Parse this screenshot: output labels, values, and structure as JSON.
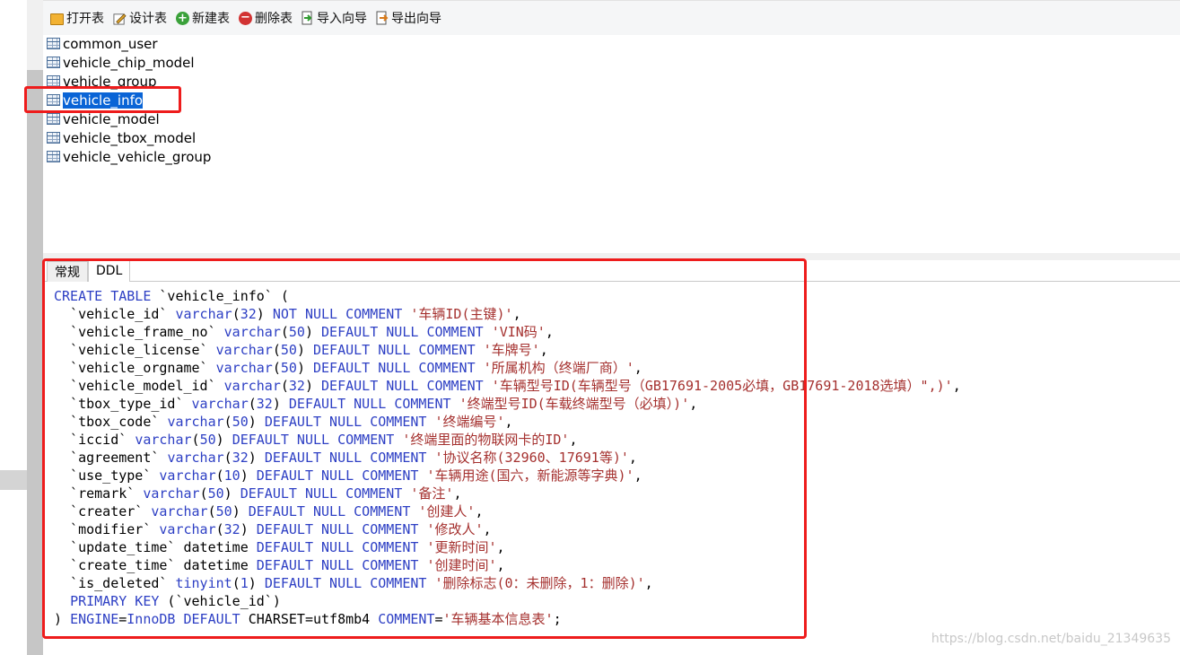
{
  "toolbar": {
    "open_table": "打开表",
    "design_table": "设计表",
    "new_table": "新建表",
    "delete_table": "删除表",
    "import_wizard": "导入向导",
    "export_wizard": "导出向导"
  },
  "tables": [
    "common_user",
    "vehicle_chip_model",
    "vehicle_group",
    "vehicle_info",
    "vehicle_model",
    "vehicle_tbox_model",
    "vehicle_vehicle_group"
  ],
  "selected_table": "vehicle_info",
  "tabs": [
    "常规",
    "DDL"
  ],
  "active_tab": "DDL",
  "ddl": {
    "header": "CREATE TABLE `vehicle_info` (",
    "columns": [
      {
        "name": "`vehicle_id`",
        "type": "varchar",
        "size": "32",
        "constraint": "NOT NULL",
        "comment": "'车辆ID(主键)'"
      },
      {
        "name": "`vehicle_frame_no`",
        "type": "varchar",
        "size": "50",
        "constraint": "DEFAULT NULL",
        "comment": "'VIN码'"
      },
      {
        "name": "`vehicle_license`",
        "type": "varchar",
        "size": "50",
        "constraint": "DEFAULT NULL",
        "comment": "'车牌号'"
      },
      {
        "name": "`vehicle_orgname`",
        "type": "varchar",
        "size": "50",
        "constraint": "DEFAULT NULL",
        "comment": "'所属机构（终端厂商）'"
      },
      {
        "name": "`vehicle_model_id`",
        "type": "varchar",
        "size": "32",
        "constraint": "DEFAULT NULL",
        "comment": "'车辆型号ID(车辆型号（GB17691-2005必填，GB17691-2018选填）\",)'"
      },
      {
        "name": "`tbox_type_id`",
        "type": "varchar",
        "size": "32",
        "constraint": "DEFAULT NULL",
        "comment": "'终端型号ID(车载终端型号（必填）)'"
      },
      {
        "name": "`tbox_code`",
        "type": "varchar",
        "size": "50",
        "constraint": "DEFAULT NULL",
        "comment": "'终端编号'"
      },
      {
        "name": "`iccid`",
        "type": "varchar",
        "size": "50",
        "constraint": "DEFAULT NULL",
        "comment": "'终端里面的物联网卡的ID'"
      },
      {
        "name": "`agreement`",
        "type": "varchar",
        "size": "32",
        "constraint": "DEFAULT NULL",
        "comment": "'协议名称(32960、17691等)'"
      },
      {
        "name": "`use_type`",
        "type": "varchar",
        "size": "10",
        "constraint": "DEFAULT NULL",
        "comment": "'车辆用途(国六，新能源等字典)'"
      },
      {
        "name": "`remark`",
        "type": "varchar",
        "size": "50",
        "constraint": "DEFAULT NULL",
        "comment": "'备注'"
      },
      {
        "name": "`creater`",
        "type": "varchar",
        "size": "50",
        "constraint": "DEFAULT NULL",
        "comment": "'创建人'"
      },
      {
        "name": "`modifier`",
        "type": "varchar",
        "size": "32",
        "constraint": "DEFAULT NULL",
        "comment": "'修改人'"
      },
      {
        "name": "`update_time`",
        "type": "datetime",
        "size": "",
        "constraint": "DEFAULT NULL",
        "comment": "'更新时间'"
      },
      {
        "name": "`create_time`",
        "type": "datetime",
        "size": "",
        "constraint": "DEFAULT NULL",
        "comment": "'创建时间'"
      },
      {
        "name": "`is_deleted`",
        "type": "tinyint",
        "size": "1",
        "constraint": "DEFAULT NULL",
        "comment": "'删除标志(0：未删除，1：删除)'"
      }
    ],
    "primary_key": "(`vehicle_id`)",
    "footer": {
      "engine": "InnoDB",
      "charset": "utf8mb4",
      "comment": "'车辆基本信息表'"
    }
  },
  "watermark": "https://blog.csdn.net/baidu_21349635"
}
